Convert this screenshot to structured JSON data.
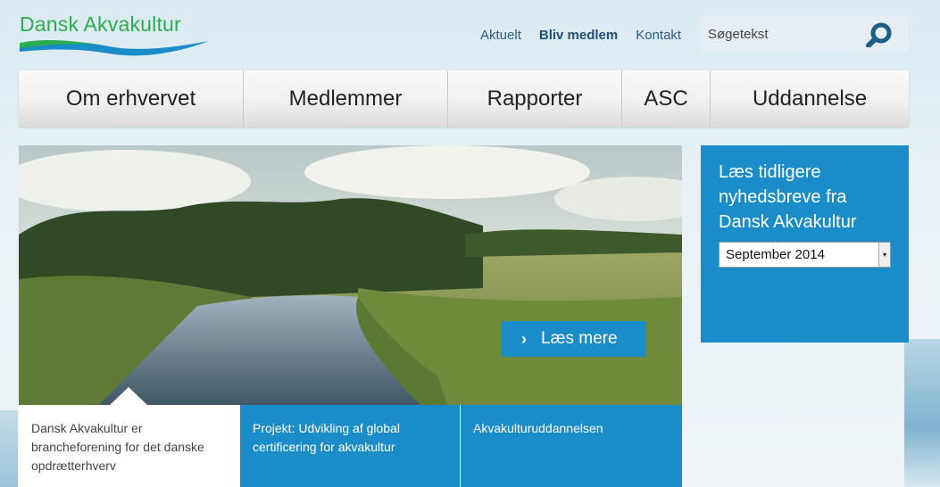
{
  "header": {
    "logo_text": "Dansk Akvakultur",
    "topnav": [
      {
        "label": "Aktuelt"
      },
      {
        "label": "Bliv medlem"
      },
      {
        "label": "Kontakt"
      }
    ],
    "search": {
      "placeholder": "Søgetekst"
    }
  },
  "mainnav": [
    {
      "label": "Om erhvervet"
    },
    {
      "label": "Medlemmer"
    },
    {
      "label": "Rapporter"
    },
    {
      "label": "ASC"
    },
    {
      "label": "Uddannelse"
    }
  ],
  "hero": {
    "read_more": "Læs mere"
  },
  "tiles": [
    {
      "text": "Dansk Akvakultur er brancheforening for det danske opdrætterhverv"
    },
    {
      "text": "Projekt: Udvikling af global certificering for akvakultur"
    },
    {
      "text": "Akvakulturuddannelsen"
    }
  ],
  "sidebar": {
    "heading": "Læs tidligere nyhedsbreve fra Dansk Akvakultur",
    "select_value": "September 2014"
  },
  "colors": {
    "brand_green": "#2bae4f",
    "brand_blue": "#1a8cc8",
    "nav_link": "#2a5e86"
  }
}
